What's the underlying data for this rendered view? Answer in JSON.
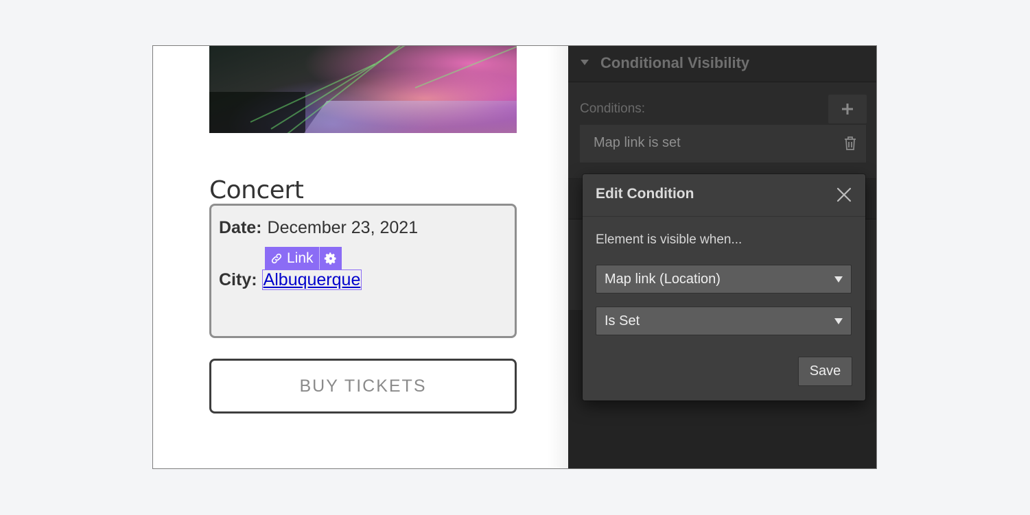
{
  "canvas": {
    "hero_image_alt": "Orchestra concert in arena with lasers",
    "title": "Concert",
    "info": {
      "date_label": "Date:",
      "date_value": "December 23, 2021",
      "city_label": "City:",
      "city_value": "Albuquerque"
    },
    "link_toolbar": {
      "link_label": "Link",
      "link_icon": "link-icon",
      "settings_icon": "gear-icon",
      "accent": "#8b6cf5"
    },
    "buy_button_label": "BUY TICKETS"
  },
  "panel": {
    "section_title": "Conditional Visibility",
    "conditions_label": "Conditions:",
    "add_icon": "plus-icon",
    "conditions": [
      {
        "text": "Map link is set",
        "icon": "trash-icon"
      }
    ]
  },
  "modal": {
    "title": "Edit Condition",
    "close_icon": "close-icon",
    "subtitle": "Element is visible when...",
    "field_select": {
      "value": "Map link (Location)"
    },
    "operator_select": {
      "value": "Is Set"
    },
    "save_label": "Save"
  }
}
